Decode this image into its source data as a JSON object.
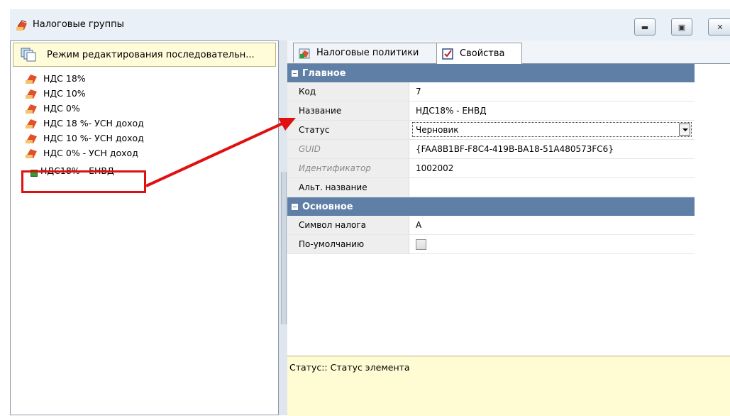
{
  "window": {
    "title": "Налоговые группы",
    "controls": [
      "minimize",
      "maximize",
      "close"
    ]
  },
  "left_panel": {
    "mode_label": "Режим редактирования последовательн...",
    "tree_items": [
      {
        "label": "НДС 18%"
      },
      {
        "label": "НДС 10%"
      },
      {
        "label": "НДС 0%"
      },
      {
        "label": "НДС 18 %- УСН доход"
      },
      {
        "label": "НДС 10 %- УСН доход"
      },
      {
        "label": "НДС 0% - УСН доход"
      },
      {
        "label": "НДС18% - ЕНВД"
      }
    ]
  },
  "tabs": [
    {
      "label": "Налоговые политики",
      "icon": "tax-policy-icon"
    },
    {
      "label": "Свойства",
      "icon": "properties-icon"
    }
  ],
  "properties": {
    "sections": [
      {
        "title": "Главное",
        "rows": [
          {
            "name": "Код",
            "value": "7"
          },
          {
            "name": "Название",
            "value": "НДС18% - ЕНВД"
          },
          {
            "name": "Статус",
            "value": "Черновик"
          },
          {
            "name": "GUID",
            "value": "{FAA8B1BF-F8C4-419B-BA18-51A480573FC6}"
          },
          {
            "name": "Идентификатор",
            "value": "1002002"
          },
          {
            "name": "Альт. название",
            "value": ""
          }
        ]
      },
      {
        "title": "Основное",
        "rows": [
          {
            "name": "Символ налога",
            "value": "A"
          },
          {
            "name": "По-умолчанию",
            "value": ""
          }
        ]
      }
    ]
  },
  "status_bar": {
    "text": "Статус:: Статус элемента"
  },
  "colors": {
    "section_header": "#5f7fa6",
    "highlight": "#e01010",
    "status_bg": "#fffbd3"
  }
}
